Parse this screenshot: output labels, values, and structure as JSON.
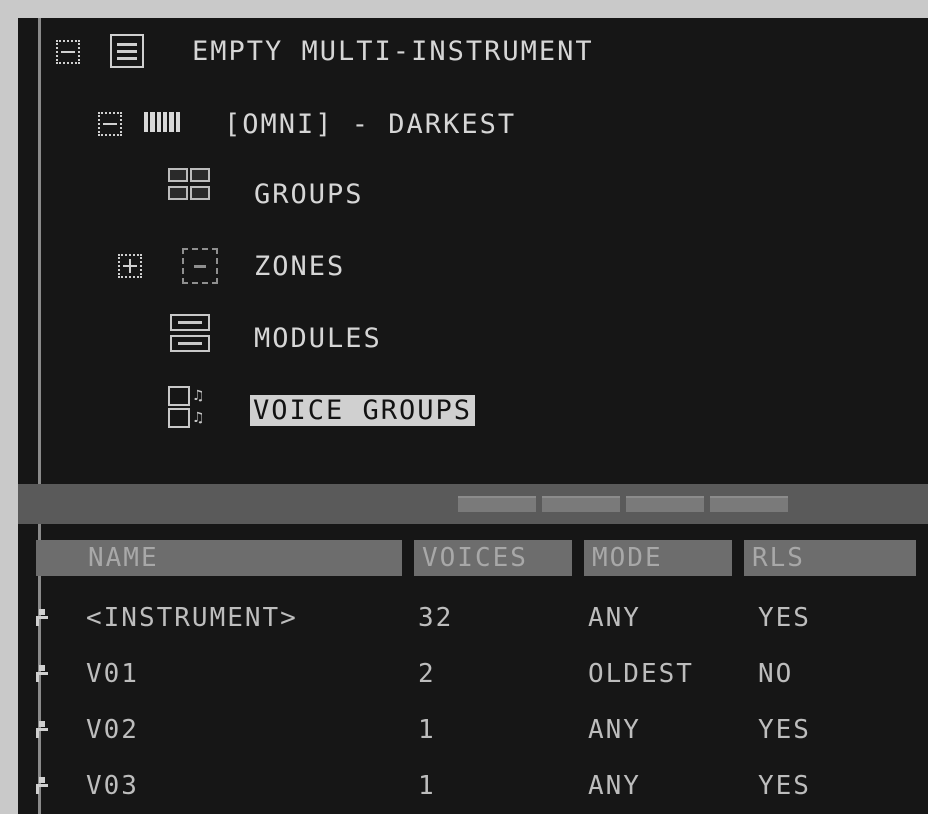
{
  "tree": {
    "root_label": "EMPTY MULTI-INSTRUMENT",
    "instrument_label": "[OMNI] - DARKEST",
    "children": [
      {
        "label": "GROUPS",
        "icon": "groups-icon"
      },
      {
        "label": "ZONES",
        "icon": "zones-icon"
      },
      {
        "label": "MODULES",
        "icon": "modules-icon"
      },
      {
        "label": "VOICE GROUPS",
        "icon": "voice-groups-icon",
        "selected": true
      }
    ]
  },
  "table": {
    "columns": [
      "NAME",
      "VOICES",
      "MODE",
      "RLS"
    ],
    "rows": [
      {
        "name": "<INSTRUMENT>",
        "voices": "32",
        "mode": "ANY",
        "rls": "YES"
      },
      {
        "name": "V01",
        "voices": "2",
        "mode": "OLDEST",
        "rls": "NO"
      },
      {
        "name": "V02",
        "voices": "1",
        "mode": "ANY",
        "rls": "YES"
      },
      {
        "name": "V03",
        "voices": "1",
        "mode": "ANY",
        "rls": "YES"
      }
    ]
  },
  "colors": {
    "background": "#161616",
    "text": "#d6d6d6",
    "selection": "#d0d0d0",
    "header": "#6d6d6d"
  }
}
